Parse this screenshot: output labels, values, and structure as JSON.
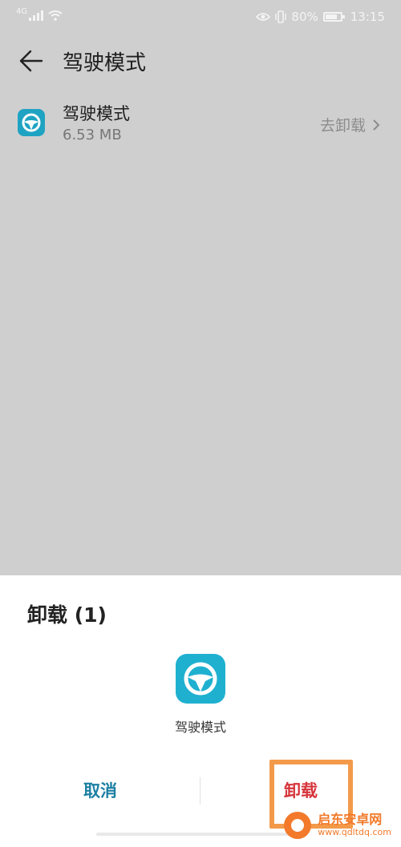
{
  "status_bar": {
    "network": "4G",
    "battery_percent": "80%",
    "battery_level": 0.8,
    "time": "13:15"
  },
  "header": {
    "title": "驾驶模式"
  },
  "app": {
    "name": "驾驶模式",
    "size": "6.53 MB",
    "uninstall_link_label": "去卸载"
  },
  "dialog": {
    "title": "卸载 (1)",
    "app_name": "驾驶模式",
    "cancel_label": "取消",
    "confirm_label": "卸载"
  },
  "watermark": {
    "brand": "启东安卓网",
    "url": "www.qdltdq.com"
  },
  "colors": {
    "accent": "#1b7fa3",
    "danger": "#d6343b",
    "app_icon": "#1fb0d0",
    "highlight": "#f39a4a"
  },
  "icons": [
    "signal-icon",
    "wifi-icon",
    "eye-icon",
    "vibrate-icon",
    "battery-icon",
    "back-arrow-icon",
    "steering-wheel-icon",
    "chevron-right-icon"
  ]
}
